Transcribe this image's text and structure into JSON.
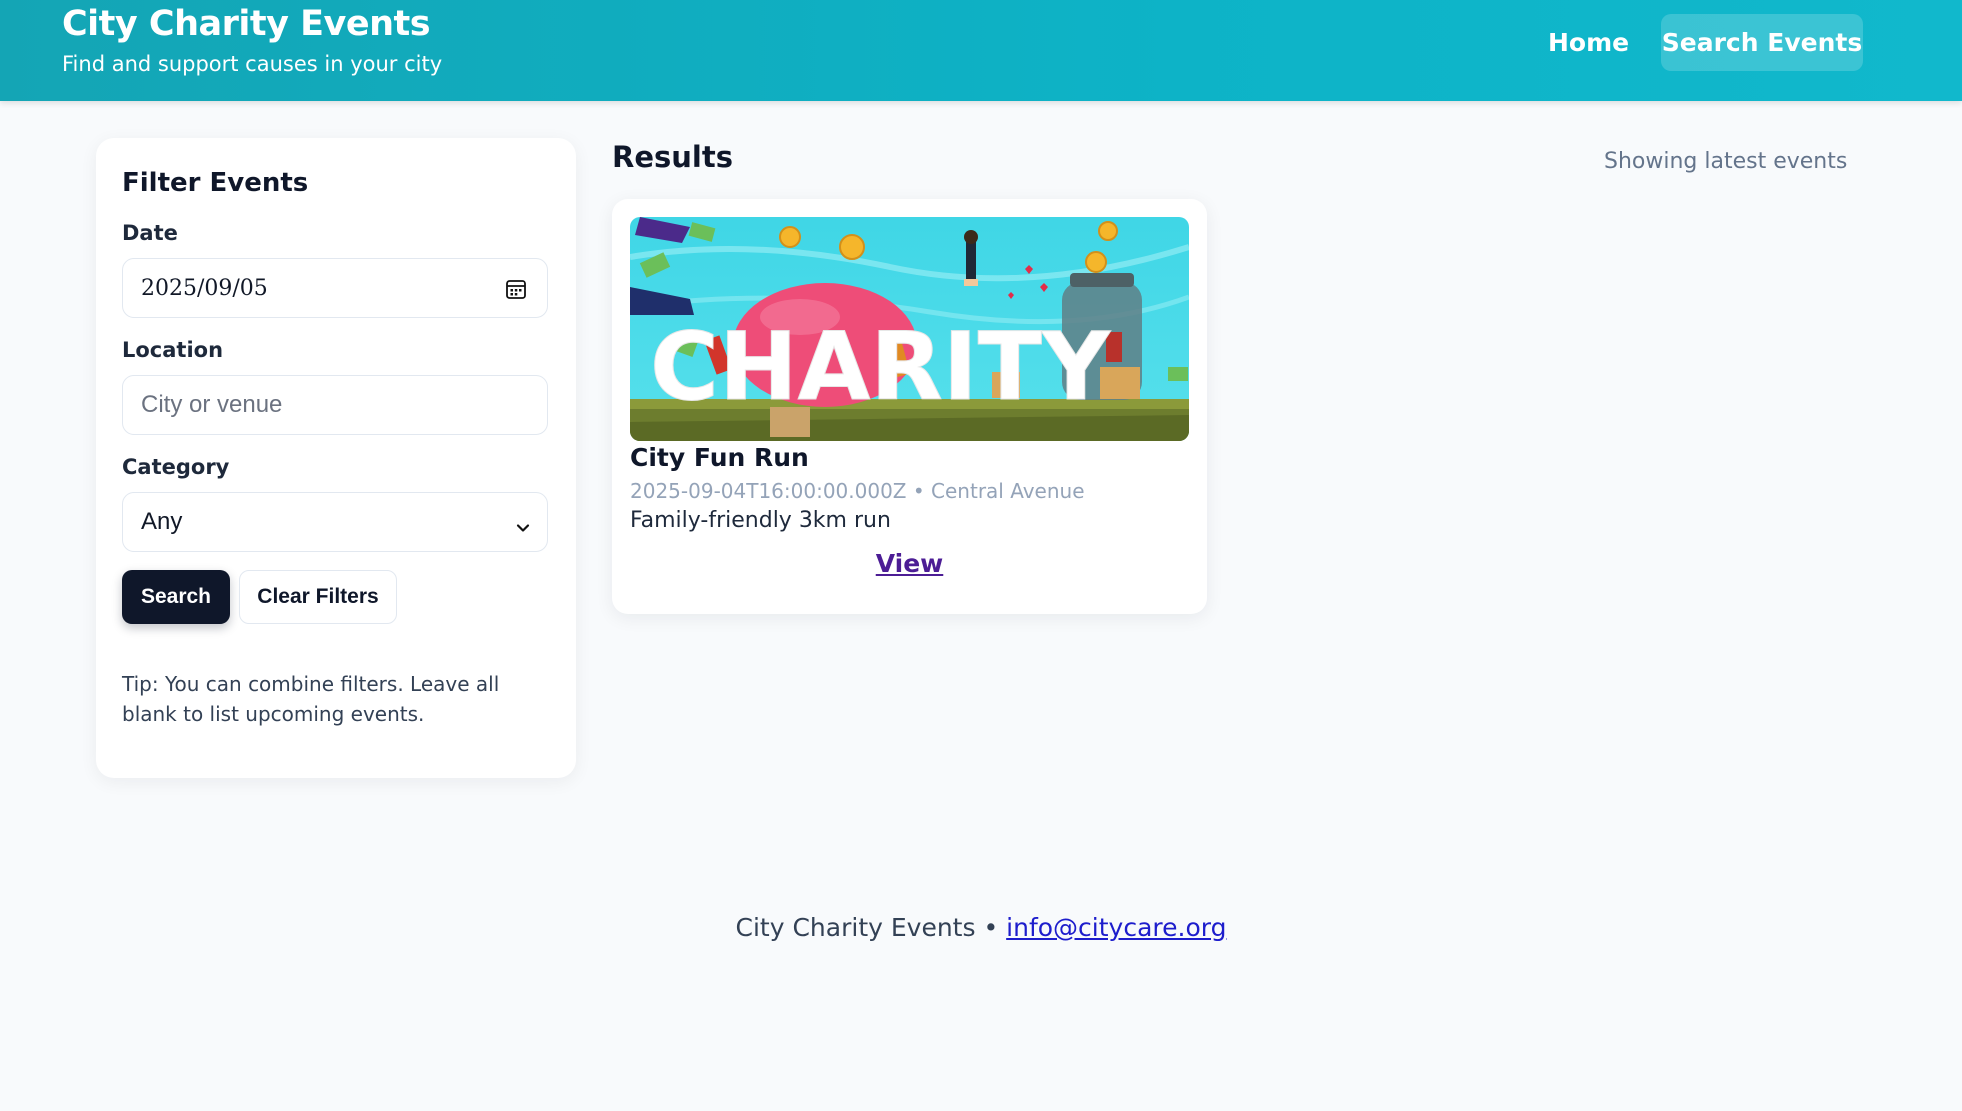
{
  "header": {
    "title": "City Charity Events",
    "subtitle": "Find and support causes in your city",
    "nav": {
      "home": "Home",
      "search": "Search Events"
    }
  },
  "filters": {
    "title": "Filter Events",
    "date": {
      "label": "Date",
      "value": "2025/09/05"
    },
    "location": {
      "label": "Location",
      "placeholder": "City or venue",
      "value": ""
    },
    "category": {
      "label": "Category",
      "selected": "Any"
    },
    "search_label": "Search",
    "clear_label": "Clear Filters",
    "tip": "Tip: You can combine filters. Leave all blank to list upcoming events."
  },
  "results": {
    "title": "Results",
    "status": "Showing latest events",
    "events": [
      {
        "name": "City Fun Run",
        "datetime": "2025-09-04T16:00:00.000Z",
        "separator": "•",
        "venue": "Central Avenue",
        "description": "Family-friendly 3km run",
        "view_label": "View",
        "image_text": "CHARITY"
      }
    ]
  },
  "footer": {
    "text": "City Charity Events •",
    "email": "info@citycare.org"
  },
  "colors": {
    "header": "#0db3c7",
    "dark_button": "#0f172a",
    "link": "#4c1d95",
    "page_bg": "#f8fafc"
  },
  "icons": [
    "calendar-icon",
    "chevron-down-icon"
  ]
}
